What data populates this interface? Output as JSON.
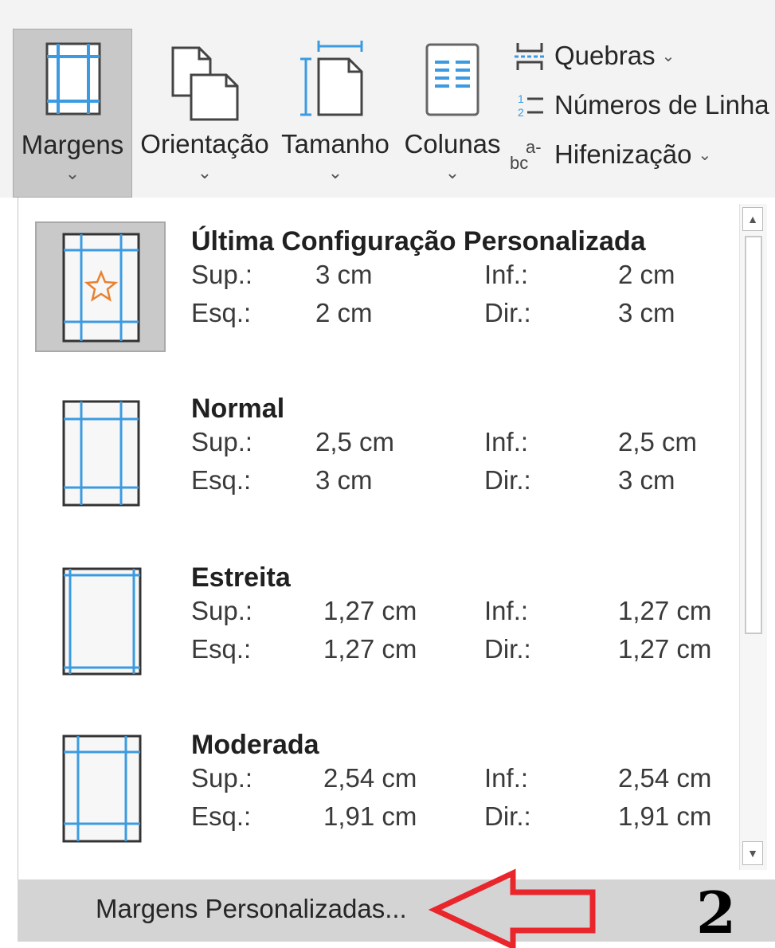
{
  "ribbon": {
    "buttons": [
      {
        "label": "Margens",
        "chevron": "⌄"
      },
      {
        "label": "Orientação",
        "chevron": "⌄"
      },
      {
        "label": "Tamanho",
        "chevron": "⌄"
      },
      {
        "label": "Colunas",
        "chevron": "⌄"
      }
    ],
    "small": [
      {
        "label": "Quebras",
        "chevron": "⌄"
      },
      {
        "label": "Números de Linha",
        "chevron": ""
      },
      {
        "label": "Hifenização",
        "chevron": "⌄"
      }
    ],
    "hyph_icon_text": "a-",
    "hyph_icon_text2": "bc",
    "line_num_icon_text": "1\n2"
  },
  "presets": [
    {
      "title": "Última Configuração Personalizada",
      "sup_label": "Sup.:",
      "sup": "3 cm",
      "inf_label": "Inf.:",
      "inf": "2 cm",
      "esq_label": "Esq.:",
      "esq": "2 cm",
      "dir_label": "Dir.:",
      "dir": "3 cm"
    },
    {
      "title": "Normal",
      "sup_label": "Sup.:",
      "sup": "2,5 cm",
      "inf_label": "Inf.:",
      "inf": "2,5 cm",
      "esq_label": "Esq.:",
      "esq": "3 cm",
      "dir_label": "Dir.:",
      "dir": "3 cm"
    },
    {
      "title": "Estreita",
      "sup_label": "Sup.:",
      "sup": "1,27 cm",
      "inf_label": "Inf.:",
      "inf": "1,27 cm",
      "esq_label": "Esq.:",
      "esq": "1,27 cm",
      "dir_label": "Dir.:",
      "dir": "1,27 cm"
    },
    {
      "title": "Moderada",
      "sup_label": "Sup.:",
      "sup": "2,54 cm",
      "inf_label": "Inf.:",
      "inf": "2,54 cm",
      "esq_label": "Esq.:",
      "esq": "1,91 cm",
      "dir_label": "Dir.:",
      "dir": "1,91 cm"
    }
  ],
  "footer": {
    "label": "Margens Personalizadas..."
  },
  "annotation": {
    "step": "2"
  },
  "colors": {
    "accent_blue": "#3c9be0",
    "arrow_red": "#e8262b",
    "star_orange": "#e8812f"
  }
}
